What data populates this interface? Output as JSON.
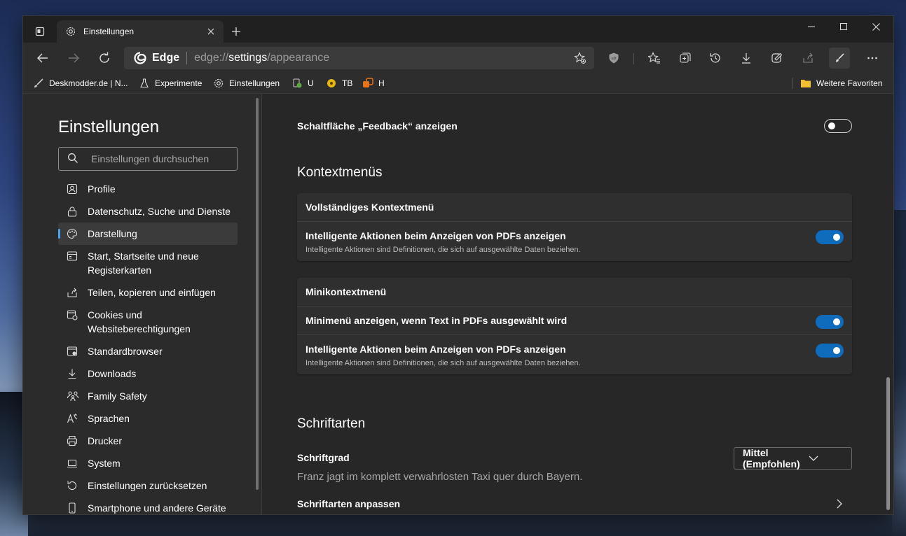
{
  "tab": {
    "title": "Einstellungen"
  },
  "address": {
    "brand": "Edge",
    "url_scheme": "edge://",
    "url_host": "settings",
    "url_path": "/appearance"
  },
  "favorites": [
    {
      "label": "Deskmodder.de | N...",
      "icon": "brush-icon"
    },
    {
      "label": "Experimente",
      "icon": "flask-icon"
    },
    {
      "label": "Einstellungen",
      "icon": "gear-icon"
    },
    {
      "label": "U",
      "icon": "extension-icon"
    },
    {
      "label": "TB",
      "icon": "coin-icon"
    },
    {
      "label": "H",
      "icon": "orange-icon"
    }
  ],
  "favorites_more": "Weitere Favoriten",
  "sidebar": {
    "title": "Einstellungen",
    "search_placeholder": "Einstellungen durchsuchen",
    "items": [
      {
        "label": "Profile"
      },
      {
        "label": "Datenschutz, Suche und Dienste"
      },
      {
        "label": "Darstellung",
        "active": true
      },
      {
        "label": "Start, Startseite und neue Registerkarten"
      },
      {
        "label": "Teilen, kopieren und einfügen"
      },
      {
        "label": "Cookies und Websiteberechtigungen"
      },
      {
        "label": "Standardbrowser"
      },
      {
        "label": "Downloads"
      },
      {
        "label": "Family Safety"
      },
      {
        "label": "Sprachen"
      },
      {
        "label": "Drucker"
      },
      {
        "label": "System"
      },
      {
        "label": "Einstellungen zurücksetzen"
      },
      {
        "label": "Smartphone und andere Geräte"
      }
    ]
  },
  "main": {
    "feedback_row": {
      "label": "Schaltfläche „Feedback“ anzeigen",
      "enabled": false
    },
    "context_title": "Kontextmenüs",
    "card1": {
      "head": "Vollständiges Kontextmenü",
      "rows": [
        {
          "title": "Intelligente Aktionen beim Anzeigen von PDFs anzeigen",
          "desc": "Intelligente Aktionen sind Definitionen, die sich auf ausgewählte Daten beziehen.",
          "enabled": true
        }
      ]
    },
    "card2": {
      "head": "Minikontextmenü",
      "rows": [
        {
          "title": "Minimenü anzeigen, wenn Text in PDFs ausgewählt wird",
          "desc": "",
          "enabled": true
        },
        {
          "title": "Intelligente Aktionen beim Anzeigen von PDFs anzeigen",
          "desc": "Intelligente Aktionen sind Definitionen, die sich auf ausgewählte Daten beziehen.",
          "enabled": true
        }
      ]
    },
    "fonts_title": "Schriftarten",
    "font_size_label": "Schriftgrad",
    "font_size_value": "Mittel (Empfohlen)",
    "font_sample": "Franz jagt im komplett verwahrlosten Taxi quer durch Bayern.",
    "customize_fonts": "Schriftarten anpassen"
  },
  "colors": {
    "accent": "#0f6cbd",
    "active_indicator": "#4aa3f0"
  }
}
